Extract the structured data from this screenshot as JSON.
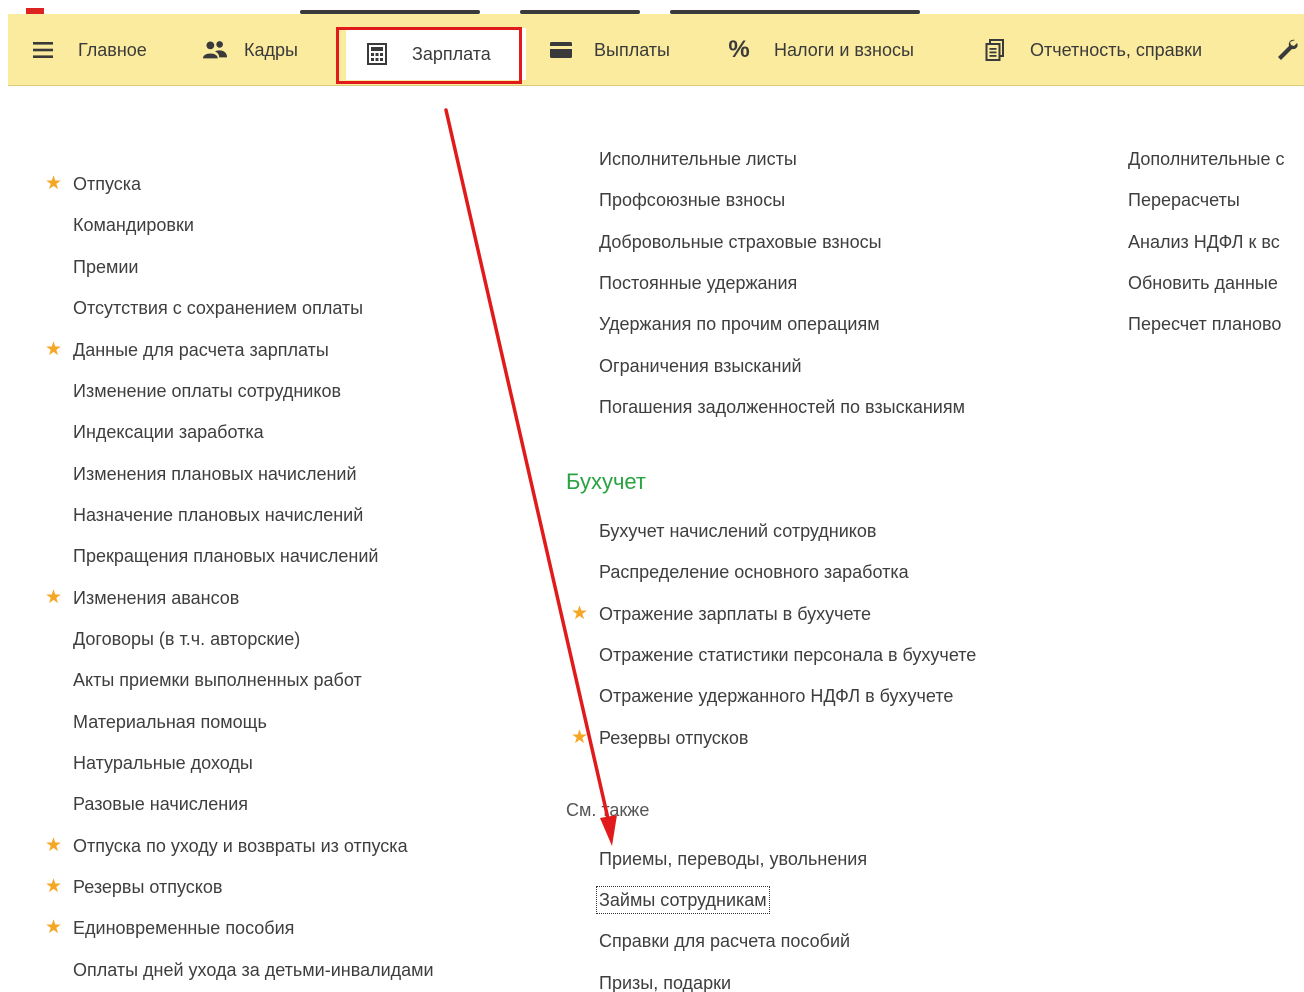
{
  "toolbar": {
    "items": [
      {
        "label": "Главное",
        "icon": "hamburger-menu-icon"
      },
      {
        "label": "Кадры",
        "icon": "people-icon"
      },
      {
        "label": "Зарплата",
        "icon": "calculator-icon"
      },
      {
        "label": "Выплаты",
        "icon": "wallet-icon"
      },
      {
        "label": "Налоги и взносы",
        "icon": "percent-icon"
      },
      {
        "label": "Отчетность, справки",
        "icon": "documents-icon"
      }
    ],
    "active_item": "Зарплата",
    "highlight_color": "#e11b1b",
    "background_color": "#fbeb9f"
  },
  "left_column": {
    "items": [
      {
        "label": "Отпуска",
        "starred": true
      },
      {
        "label": "Командировки",
        "starred": false
      },
      {
        "label": "Премии",
        "starred": false
      },
      {
        "label": "Отсутствия с сохранением оплаты",
        "starred": false
      },
      {
        "label": "Данные для расчета зарплаты",
        "starred": true
      },
      {
        "label": "Изменение оплаты сотрудников",
        "starred": false
      },
      {
        "label": "Индексации заработка",
        "starred": false
      },
      {
        "label": "Изменения плановых начислений",
        "starred": false
      },
      {
        "label": "Назначение плановых начислений",
        "starred": false
      },
      {
        "label": "Прекращения плановых начислений",
        "starred": false
      },
      {
        "label": "Изменения авансов",
        "starred": true
      },
      {
        "label": "Договоры (в т.ч. авторские)",
        "starred": false
      },
      {
        "label": "Акты приемки выполненных работ",
        "starred": false
      },
      {
        "label": "Материальная помощь",
        "starred": false
      },
      {
        "label": "Натуральные доходы",
        "starred": false
      },
      {
        "label": "Разовые начисления",
        "starred": false
      },
      {
        "label": "Отпуска по уходу и возвраты из отпуска",
        "starred": true
      },
      {
        "label": "Резервы отпусков",
        "starred": true
      },
      {
        "label": "Единовременные пособия",
        "starred": true
      },
      {
        "label": "Оплаты дней ухода за детьми-инвалидами",
        "starred": false
      }
    ]
  },
  "middle_column": {
    "cut_top_item": "Исполнительные листы",
    "deductions": [
      {
        "label": "Профсоюзные взносы"
      },
      {
        "label": "Добровольные страховые взносы"
      },
      {
        "label": "Постоянные удержания"
      },
      {
        "label": "Удержания по прочим операциям"
      },
      {
        "label": "Ограничения взысканий"
      },
      {
        "label": "Погашения задолженностей по взысканиям"
      }
    ],
    "accounting_title": "Бухучет",
    "accounting": [
      {
        "label": "Бухучет начислений сотрудников",
        "starred": false
      },
      {
        "label": "Распределение основного заработка",
        "starred": false
      },
      {
        "label": "Отражение зарплаты в бухучете",
        "starred": true
      },
      {
        "label": "Отражение статистики персонала в бухучете",
        "starred": false
      },
      {
        "label": "Отражение удержанного НДФЛ в бухучете",
        "starred": false
      },
      {
        "label": "Резервы отпусков",
        "starred": true
      }
    ],
    "see_also_title": "См. также",
    "see_also": [
      {
        "label": "Приемы, переводы, увольнения"
      },
      {
        "label": "Займы сотрудникам"
      },
      {
        "label": "Справки для расчета пособий"
      },
      {
        "label": "Призы, подарки"
      }
    ]
  },
  "right_column": {
    "cut_top_item": "Дополнительные с",
    "items": [
      {
        "label": "Перерасчеты"
      },
      {
        "label": "Анализ НДФЛ к вс"
      },
      {
        "label": "Обновить данные"
      },
      {
        "label": "Пересчет планово"
      }
    ]
  }
}
